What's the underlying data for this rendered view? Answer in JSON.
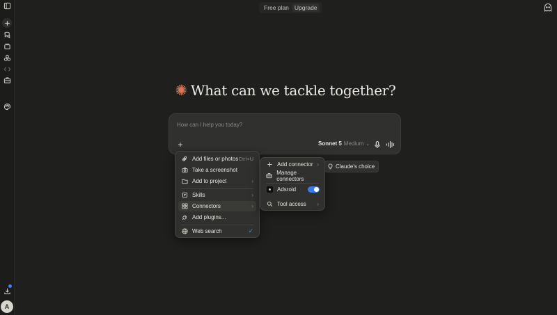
{
  "header": {
    "plan_label": "Free plan",
    "upgrade_label": "Upgrade"
  },
  "sidebar": {
    "items": [
      {
        "icon": "sidebar-toggle-icon"
      },
      {
        "icon": "new-chat-icon"
      },
      {
        "icon": "chats-icon"
      },
      {
        "icon": "projects-icon"
      },
      {
        "icon": "artifacts-icon"
      },
      {
        "icon": "code-icon"
      },
      {
        "icon": "briefcase-icon"
      },
      {
        "icon": "palette-icon"
      },
      {
        "icon": "download-icon"
      }
    ],
    "avatar_initial": "A"
  },
  "main": {
    "heading": "What can we tackle together?",
    "composer": {
      "placeholder": "How can I help you today?",
      "model_name": "Sonnet 5",
      "model_mode": "Medium"
    }
  },
  "plus_menu": {
    "items": [
      {
        "label": "Add files or photos",
        "shortcut": "Ctrl+U",
        "icon": "paperclip-icon"
      },
      {
        "label": "Take a screenshot",
        "icon": "camera-icon"
      },
      {
        "label": "Add to project",
        "icon": "folder-icon",
        "submenu": true
      },
      {
        "label": "Skills",
        "icon": "skills-icon",
        "submenu": true
      },
      {
        "label": "Connectors",
        "icon": "connectors-icon",
        "submenu": true,
        "highlighted": true
      },
      {
        "label": "Add plugins...",
        "icon": "plug-icon"
      },
      {
        "label": "Web search",
        "icon": "globe-icon",
        "checked": true
      }
    ]
  },
  "connectors_menu": {
    "items": [
      {
        "label": "Add connector",
        "icon": "plus-icon",
        "submenu": true
      },
      {
        "label": "Manage connectors",
        "icon": "toolbox-icon"
      },
      {
        "label": "Adsroid",
        "icon": "adsroid-app-icon",
        "toggle": true
      },
      {
        "label": "Tool access",
        "icon": "search-icon",
        "submenu": true
      }
    ]
  },
  "choice_chip": {
    "label": "Claude's choice",
    "icon": "lightbulb-icon"
  },
  "colors": {
    "background": "#1f1f1e",
    "accent_star": "#d97757",
    "toggle_on": "#3b7be8",
    "check": "#4a8bf5"
  }
}
